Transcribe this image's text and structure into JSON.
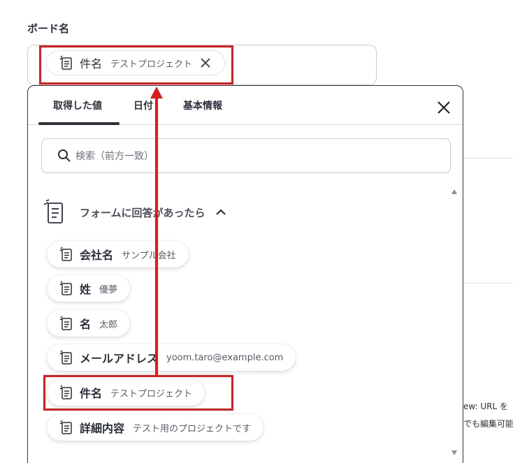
{
  "field": {
    "label": "ボード名"
  },
  "selected_chip": {
    "name": "件名",
    "value": "テストプロジェクト"
  },
  "dropdown": {
    "tabs": [
      {
        "label": "取得した値"
      },
      {
        "label": "日付"
      },
      {
        "label": "基本情報"
      }
    ],
    "active_tab": "取得した値",
    "search": {
      "placeholder": "検索（前方一致）"
    },
    "group": {
      "label": "フォームに回答があったら"
    },
    "items": [
      {
        "name": "会社名",
        "value": "サンプル会社"
      },
      {
        "name": "姓",
        "value": "優夢"
      },
      {
        "name": "名",
        "value": "太郎"
      },
      {
        "name": "メールアドレス",
        "value": "yoom.taro@example.com"
      },
      {
        "name": "件名",
        "value": "テストプロジェクト"
      },
      {
        "name": "詳細内容",
        "value": "テスト用のプロジェクトです"
      }
    ]
  },
  "background": {
    "text_line1": "ew: URL を",
    "text_line2": "でも編集可能"
  },
  "colors": {
    "highlight": "#e01b1b",
    "text": "#2b2f3a",
    "border": "#c9ccd3"
  }
}
